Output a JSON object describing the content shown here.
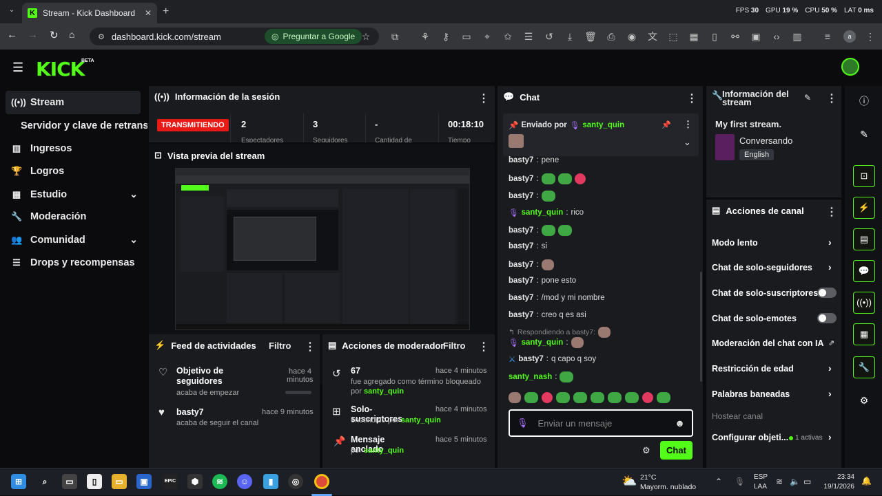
{
  "browser": {
    "tab_title": "Stream - Kick Dashboard",
    "url": "dashboard.kick.com/stream",
    "google_button": "Preguntar a Google",
    "perf": {
      "fps_label": "FPS",
      "fps": "30",
      "gpu_label": "GPU",
      "gpu": "19 %",
      "cpu_label": "CPU",
      "cpu": "50 %",
      "lat_label": "LAT",
      "lat": "0 ms"
    }
  },
  "brand": {
    "logo": "KICK",
    "beta": "BETA",
    "accent": "#53fc18",
    "live_color": "#e91916"
  },
  "sidebar": {
    "items": [
      {
        "label": "Stream",
        "icon": "broadcast-icon"
      },
      {
        "label": "Servidor y clave de retransm"
      },
      {
        "label": "Ingresos",
        "icon": "bars-icon"
      },
      {
        "label": "Logros",
        "icon": "trophy-icon"
      },
      {
        "label": "Estudio",
        "icon": "studio-icon"
      },
      {
        "label": "Moderación",
        "icon": "wrench-icon"
      },
      {
        "label": "Comunidad",
        "icon": "people-icon"
      },
      {
        "label": "Drops y recompensas",
        "icon": "list-icon"
      }
    ]
  },
  "session": {
    "title": "Información de la sesión",
    "status": "TRANSMITIENDO",
    "stats": [
      {
        "value": "2",
        "label": "Espectadores"
      },
      {
        "value": "3",
        "label": "Seguidores"
      },
      {
        "value": "-",
        "label": "Cantidad de"
      },
      {
        "value": "00:18:10",
        "label": "Tiempo"
      }
    ]
  },
  "preview": {
    "title": "Vista previa del stream"
  },
  "feed": {
    "title": "Feed de actividades",
    "filter": "Filtro",
    "items": [
      {
        "title": "Objetivo de seguidores",
        "sub": "acaba de empezar",
        "time": "hace 4 minutos",
        "progress": 0
      },
      {
        "title": "basty7",
        "sub": "acaba de seguir el canal",
        "time": "hace 9 minutos"
      }
    ]
  },
  "modactions": {
    "title": "Acciones de moderador",
    "filter": "Filtro",
    "items": [
      {
        "title": "67",
        "sub": "fue agregado como término bloqueado",
        "by": "por",
        "user": "santy_quin",
        "time": "hace 4 minutos"
      },
      {
        "title": "Solo-suscriptores",
        "sub": "encendido por",
        "user": "santy_quin",
        "time": "hace 4 minutos"
      },
      {
        "title": "Mensaje anclado",
        "by": "por",
        "user": "santy_quin",
        "time": "hace 5 minutos"
      }
    ]
  },
  "chat": {
    "title": "Chat",
    "pinned_by_label": "Enviado por",
    "pinned_user": "santy_quin",
    "messages": [
      {
        "user": "basty7",
        "text": "pene"
      },
      {
        "user": "basty7",
        "text": ""
      },
      {
        "user": "basty7",
        "text": ""
      },
      {
        "user": "santy_quin",
        "text": "rico"
      },
      {
        "user": "basty7",
        "text": ""
      },
      {
        "user": "basty7",
        "text": "si"
      },
      {
        "user": "basty7",
        "text": ""
      },
      {
        "user": "basty7",
        "text": "pone esto"
      },
      {
        "user": "basty7",
        "text": "/mod y mi nombre"
      },
      {
        "user": "basty7",
        "text": "creo q es asi"
      }
    ],
    "reply_label": "Respondiendo a basty7:",
    "reply_user": "santy_quin",
    "msg_mod_user": "basty7",
    "msg_mod_text": "q capo q soy",
    "last_user": "santy_nash",
    "input_placeholder": "Enviar un mensaje",
    "send_button": "Chat"
  },
  "streaminfo": {
    "title": "Información del stream",
    "stream_title": "My first stream.",
    "category": "Conversando",
    "language": "English"
  },
  "channelactions": {
    "title": "Acciones de canal",
    "items": [
      {
        "label": "Modo lento",
        "control": "chevron"
      },
      {
        "label": "Chat de solo-seguidores",
        "control": "chevron"
      },
      {
        "label": "Chat de solo-suscriptores",
        "control": "toggle"
      },
      {
        "label": "Chat de solo-emotes",
        "control": "toggle"
      },
      {
        "label": "Moderación del chat con IA",
        "control": "external"
      },
      {
        "label": "Restricción de edad",
        "control": "chevron"
      },
      {
        "label": "Palabras baneadas",
        "control": "chevron"
      },
      {
        "label": "Hostear canal",
        "control": "none"
      },
      {
        "label": "Configurar objeti...",
        "control": "chevron",
        "badge": "1 activas"
      }
    ]
  },
  "taskbar": {
    "weather_temp": "21°C",
    "weather_desc": "Mayorm. nublado",
    "lang": "ESP",
    "lang2": "LAA",
    "time": "23:34",
    "date": "19/1/2026"
  }
}
